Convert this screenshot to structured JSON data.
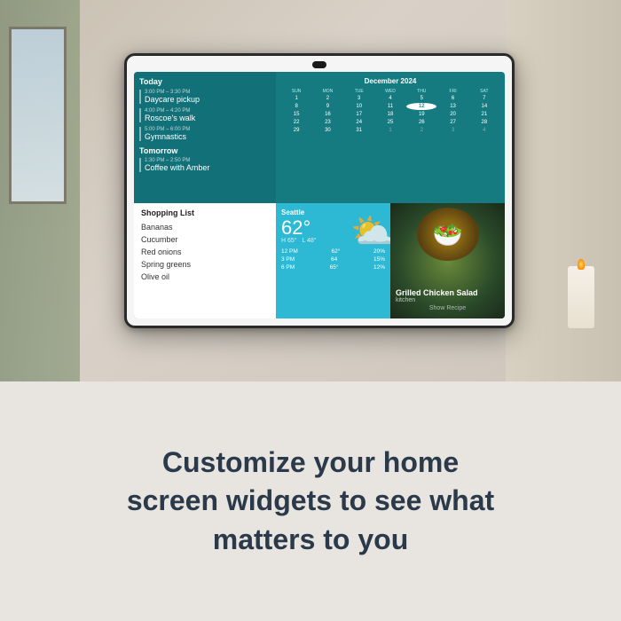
{
  "device": {
    "camera_label": "camera"
  },
  "agenda": {
    "today_label": "Today",
    "tomorrow_label": "Tomorrow",
    "events": [
      {
        "time": "3:00 PM – 3:30 PM",
        "title": "Daycare pickup"
      },
      {
        "time": "4:00 PM – 4:20 PM",
        "title": "Roscoe's walk"
      },
      {
        "time": "5:00 PM – 6:00 PM",
        "title": "Gymnastics"
      },
      {
        "time": "1:30 PM – 2:50 PM",
        "title": "Coffee with Amber"
      }
    ]
  },
  "calendar": {
    "title": "December 2024",
    "headers": [
      "SUN",
      "MON",
      "TUE",
      "WED",
      "THU",
      "FRI",
      "SAT"
    ],
    "days_prev": [],
    "days": [
      "1",
      "2",
      "3",
      "4",
      "5",
      "6",
      "7",
      "8",
      "9",
      "10",
      "11",
      "12",
      "13",
      "14",
      "15",
      "16",
      "17",
      "18",
      "19",
      "20",
      "21",
      "22",
      "23",
      "24",
      "25",
      "26",
      "27",
      "28",
      "29",
      "30",
      "31",
      "1",
      "2",
      "3",
      "4"
    ],
    "today": "12"
  },
  "shopping": {
    "title": "Shopping List",
    "items": [
      "Bananas",
      "Cucumber",
      "Red onions",
      "Spring greens",
      "Olive oil"
    ]
  },
  "weather": {
    "location": "Seattle",
    "temp": "62°",
    "high": "H 65°",
    "low": "L 48°",
    "forecast": [
      {
        "time": "12 PM",
        "temp": "62°",
        "precip": "20%"
      },
      {
        "time": "3 PM",
        "temp": "64",
        "precip": "15%"
      },
      {
        "time": "6 PM",
        "temp": "65°",
        "precip": "12%"
      }
    ]
  },
  "recipe": {
    "name": "Grilled Chicken Salad",
    "source": "kitchen",
    "cta": "Show Recipe"
  },
  "tagline": {
    "line1": "Customize your home",
    "line2": "screen widgets to see what",
    "line3": "matters to you"
  }
}
